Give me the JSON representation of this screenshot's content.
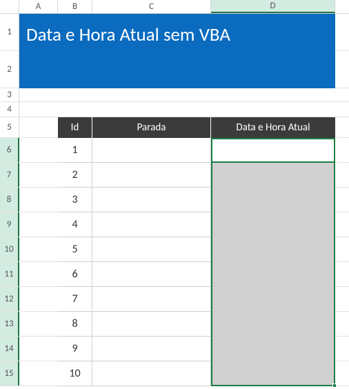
{
  "columns": {
    "A": "A",
    "B": "B",
    "C": "C",
    "D": "D"
  },
  "row_labels": [
    "1",
    "2",
    "3",
    "4",
    "5",
    "6",
    "7",
    "8",
    "9",
    "10",
    "11",
    "12",
    "13",
    "14",
    "15"
  ],
  "banner": {
    "title": "Data e Hora Atual sem VBA"
  },
  "table": {
    "headers": {
      "id": "Id",
      "parada": "Parada",
      "datahora": "Data e Hora Atual"
    },
    "rows": [
      {
        "id": "1",
        "parada": "",
        "datahora": ""
      },
      {
        "id": "2",
        "parada": "",
        "datahora": ""
      },
      {
        "id": "3",
        "parada": "",
        "datahora": ""
      },
      {
        "id": "4",
        "parada": "",
        "datahora": ""
      },
      {
        "id": "5",
        "parada": "",
        "datahora": ""
      },
      {
        "id": "6",
        "parada": "",
        "datahora": ""
      },
      {
        "id": "7",
        "parada": "",
        "datahora": ""
      },
      {
        "id": "8",
        "parada": "",
        "datahora": ""
      },
      {
        "id": "9",
        "parada": "",
        "datahora": ""
      },
      {
        "id": "10",
        "parada": "",
        "datahora": ""
      }
    ]
  },
  "selection": {
    "active_cell": "D6",
    "range": "D6:D15",
    "selected_column": "D"
  },
  "colors": {
    "banner_bg": "#0a6bbf",
    "table_header_bg": "#3b3b3b",
    "selection_border": "#1a7f46",
    "fill_grey": "#d0d0d0"
  }
}
